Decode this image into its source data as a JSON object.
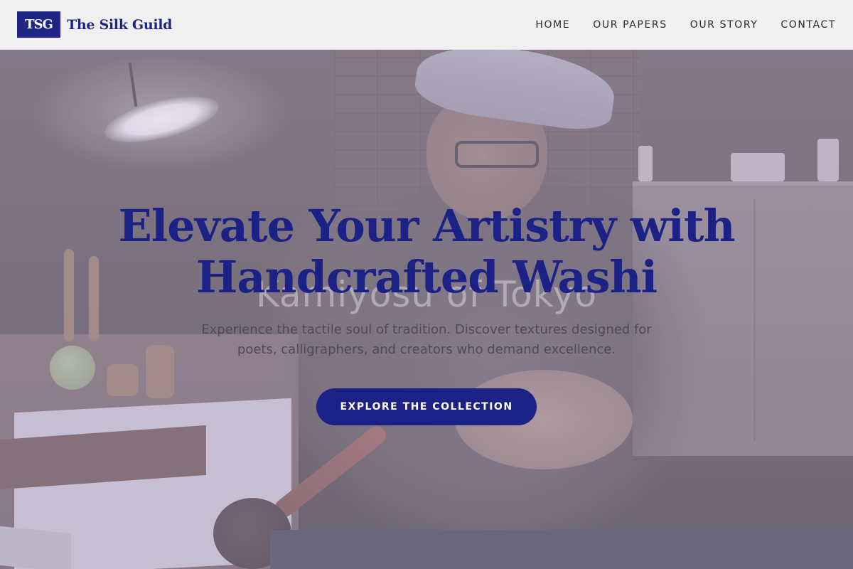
{
  "brand": {
    "logo_mark": "TSG",
    "name": "The Silk Guild",
    "color": "#1e2585"
  },
  "nav": {
    "items": [
      {
        "label": "HOME"
      },
      {
        "label": "OUR PAPERS"
      },
      {
        "label": "OUR STORY"
      },
      {
        "label": "CONTACT"
      }
    ]
  },
  "hero": {
    "title_line1": "Elevate Your Artistry with",
    "title_line2": "Handcrafted Washi",
    "watermark": "Kamiyosu of Tokyo",
    "subtitle": "Experience the tactile soul of tradition. Discover textures designed for poets, calligraphers, and creators who demand excellence.",
    "cta_label": "EXPLORE THE COLLECTION",
    "background_image": "craftsman-at-workbench-photo",
    "overlay_color": "#c4bad6"
  },
  "colors": {
    "accent": "#1c2285",
    "header_bg": "#f5f5f5",
    "nav_text": "#2a2a2a",
    "subtitle_text": "#4e4a57"
  }
}
